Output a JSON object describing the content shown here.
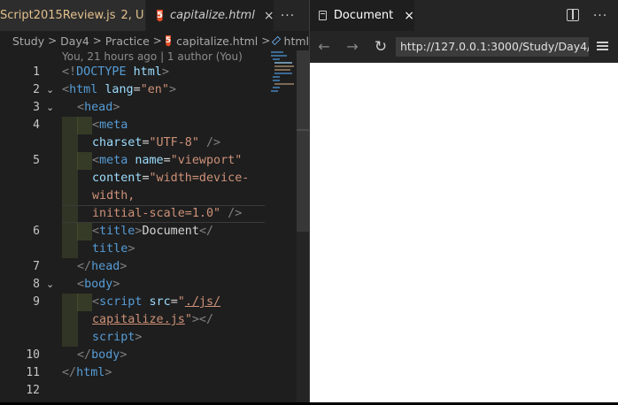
{
  "editor": {
    "tabs": [
      {
        "label": "Script2015Review.js",
        "status": "2, U"
      },
      {
        "label": "capitalize.html",
        "icon": "html5-icon",
        "close": "×"
      }
    ],
    "more": "···",
    "breadcrumb": {
      "items": [
        "Study",
        "Day4",
        "Practice",
        "capitalize.html",
        "html"
      ],
      "separator": ">"
    },
    "blame": "You, 21 hours ago | 1 author (You)",
    "line_numbers": [
      "1",
      "2",
      "3",
      "4",
      "5",
      "6",
      "7",
      "8",
      "9",
      "10",
      "11",
      "12"
    ],
    "code": {
      "l1a": "<!",
      "l1b": "DOCTYPE",
      "l1c": " html",
      "l1d": ">",
      "l2a": "<",
      "l2b": "html",
      "l2c": " lang",
      "l2d": "=",
      "l2e": "\"en\"",
      "l2f": ">",
      "l3a": "<",
      "l3b": "head",
      "l3c": ">",
      "l4a": "<",
      "l4b": "meta",
      "l4w_a": "charset",
      "l4w_b": "=",
      "l4w_c": "\"UTF-8\"",
      "l4w_d": " />",
      "l5a": "<",
      "l5b": "meta",
      "l5c": " name",
      "l5d": "=",
      "l5e": "\"viewport\"",
      "l5w1_a": "content",
      "l5w1_b": "=",
      "l5w1_c": "\"width=device-",
      "l5w2": "width,",
      "l5w3_a": "initial-scale=1.0\"",
      "l5w3_b": " />",
      "l6a": "<",
      "l6b": "title",
      "l6c": ">",
      "l6d": "Document",
      "l6e": "</",
      "l6w_a": "title",
      "l6w_b": ">",
      "l7a": "</",
      "l7b": "head",
      "l7c": ">",
      "l8a": "<",
      "l8b": "body",
      "l8c": ">",
      "l9a": "<",
      "l9b": "script",
      "l9c": " src",
      "l9d": "=",
      "l9e": "\"",
      "l9f": "./js/",
      "l9w1_a": "capitalize.js",
      "l9w1_b": "\"",
      "l9w1_c": "></",
      "l9w2_a": "script",
      "l9w2_b": ">",
      "l10a": "</",
      "l10b": "body",
      "l10c": ">",
      "l11a": "</",
      "l11b": "html",
      "l11c": ">"
    }
  },
  "browser": {
    "tab_title": "Document",
    "close": "×",
    "more": "···",
    "url": "http://127.0.0.1:3000/Study/Day4/Pr",
    "nav": {
      "back": "←",
      "forward": "→",
      "reload": "↻"
    }
  },
  "colors": {
    "tag": "#569cd6",
    "attr": "#9cdcfe",
    "string": "#ce9178",
    "punct": "#808080",
    "text": "#d4d4d4",
    "modified": "#e2c08d",
    "html5": "#e44d26"
  }
}
